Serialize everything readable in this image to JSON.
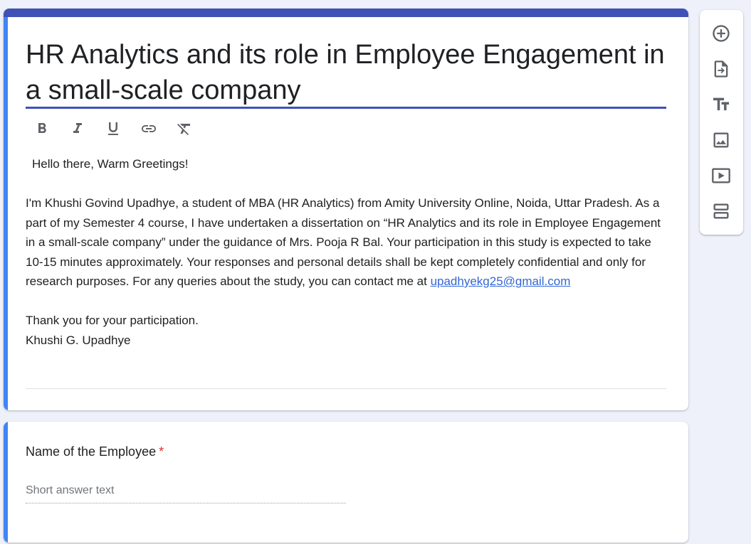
{
  "form": {
    "title": "HR Analytics and its role in Employee Engagement in a small-scale company",
    "description": {
      "greeting": "Hello there, Warm Greetings!",
      "body": "I'm Khushi Govind Upadhye, a student of MBA (HR Analytics) from Amity University Online, Noida, Uttar Pradesh. As a part of my Semester 4 course, I have undertaken a dissertation on “HR Analytics and its role in Employee Engagement in a small-scale company” under the guidance of Mrs. Pooja R Bal. Your participation in this study is expected to take 10-15 minutes approximately. Your responses and personal details shall be kept completely confidential and only for research purposes. For any queries about the study, you can contact me at ",
      "email": "upadhyekg25@gmail.com",
      "thanks": "Thank you for your participation.",
      "signature": "Khushi G. Upadhye"
    }
  },
  "toolbar": {
    "items": [
      "bold-icon",
      "italic-icon",
      "underline-icon",
      "link-icon",
      "clear-formatting-icon"
    ]
  },
  "question": {
    "title": "Name of the Employee",
    "required_mark": "*",
    "placeholder": "Short answer text"
  },
  "side_toolbar": {
    "items": [
      "add-question-icon",
      "import-questions-icon",
      "add-title-icon",
      "add-image-icon",
      "add-video-icon",
      "add-section-icon"
    ]
  },
  "colors": {
    "theme": "#3f51b5",
    "accent": "#4285f4",
    "background": "#eff1fa",
    "required": "#d93025",
    "link": "#3367d6"
  }
}
